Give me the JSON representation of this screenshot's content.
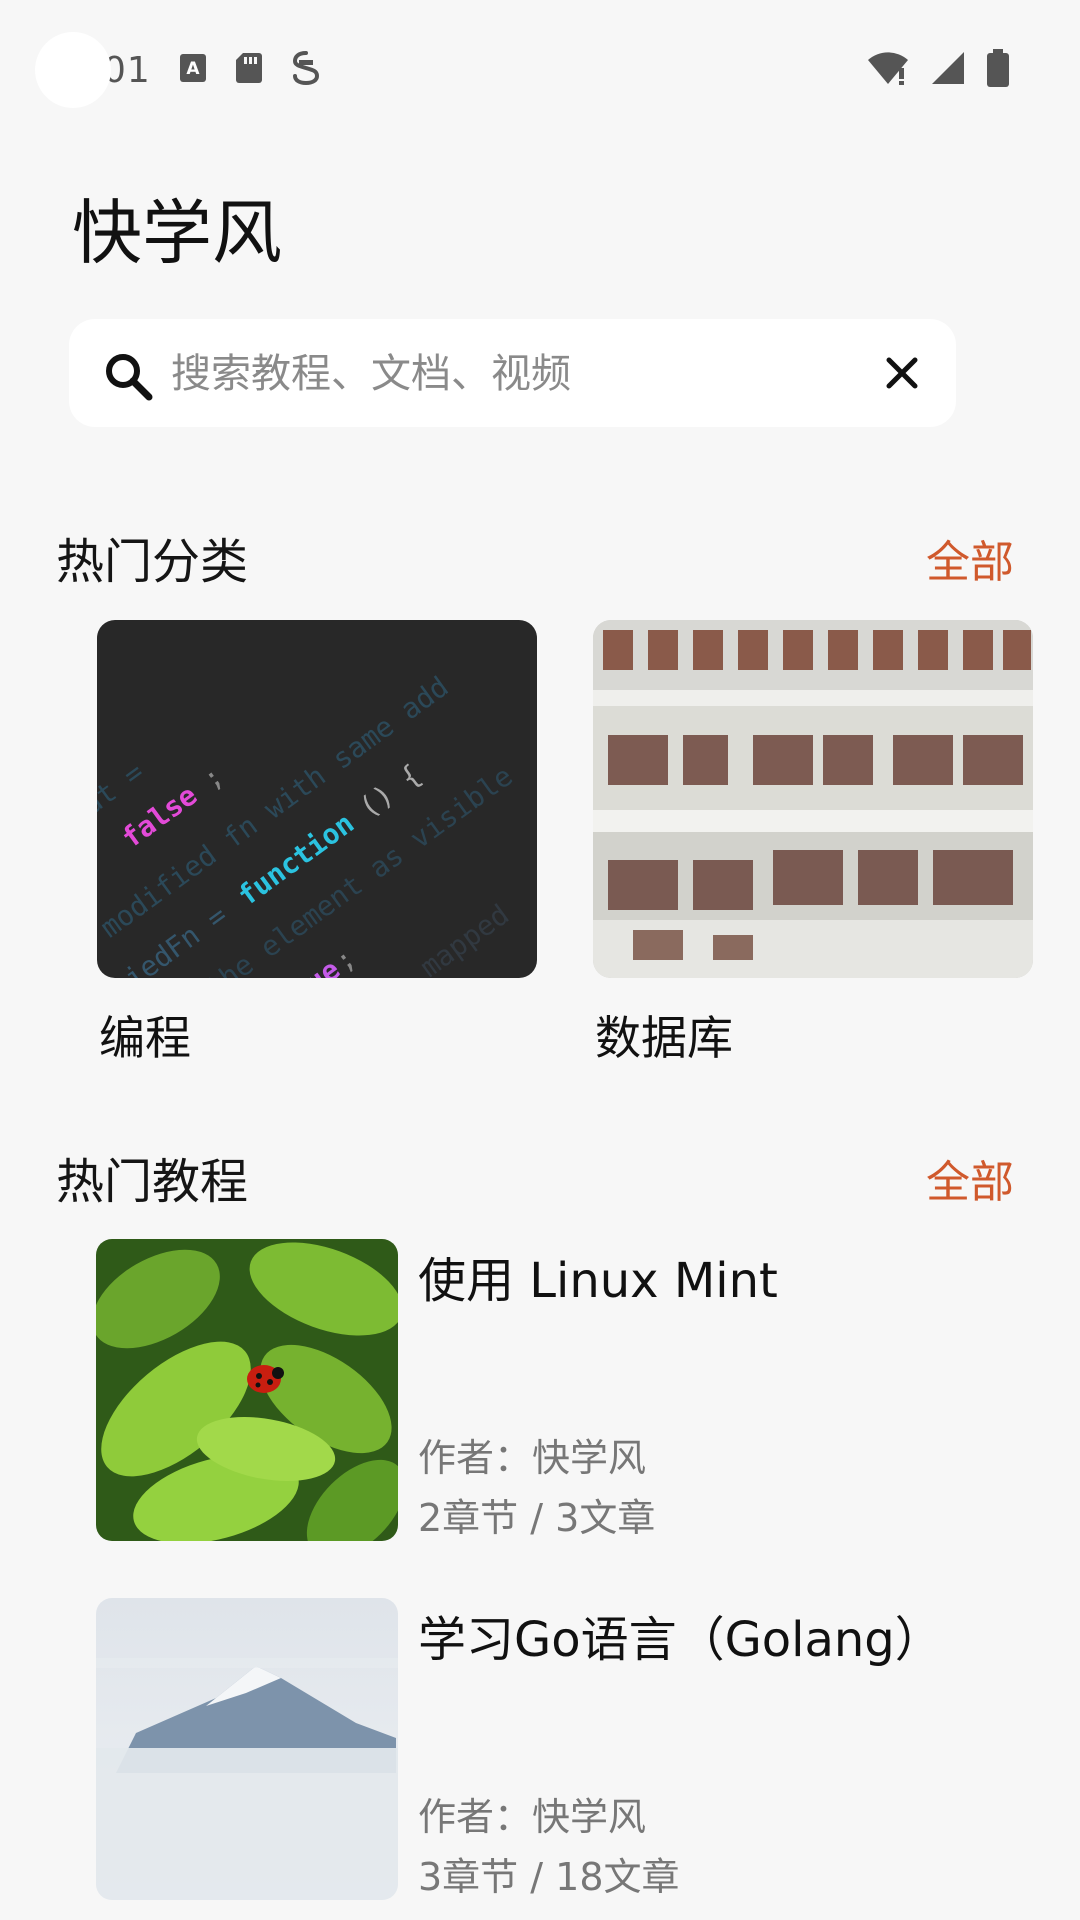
{
  "status_bar": {
    "time": "01",
    "icons": [
      "a-notification-icon",
      "sd-card-icon",
      "vpn-icon",
      "wifi-alert-icon",
      "signal-icon",
      "battery-icon"
    ]
  },
  "app": {
    "title": "快学风"
  },
  "search": {
    "placeholder": "搜索教程、文档、视频",
    "value": ""
  },
  "categories_section": {
    "title": "热门分类",
    "see_all": "全部",
    "items": [
      {
        "label": "编程",
        "image": "code-screenshot"
      },
      {
        "label": "数据库",
        "image": "library-interior"
      }
    ]
  },
  "tutorials_section": {
    "title": "热门教程",
    "see_all": "全部",
    "items": [
      {
        "title": "使用 Linux Mint",
        "author": "作者：快学风",
        "stats": "2章节 / 3文章",
        "image": "ladybug-leaves"
      },
      {
        "title": "学习Go语言（Golang）",
        "author": "作者：快学风",
        "stats": "3章节 / 18文章",
        "image": "misty-mountain"
      }
    ]
  },
  "colors": {
    "accent": "#d0592c",
    "background": "#f7f7f7",
    "card": "#ffffff"
  }
}
